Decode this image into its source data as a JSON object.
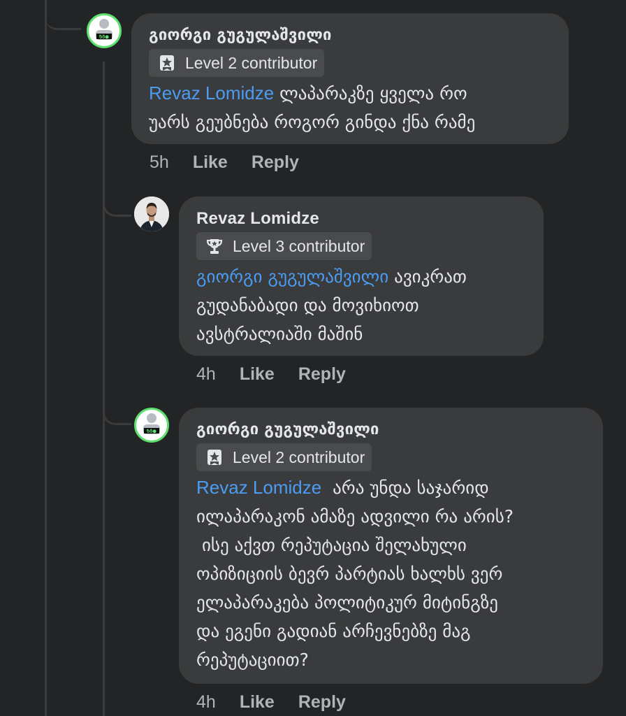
{
  "comments": [
    {
      "author": "გიორგი გუგულაშვილი",
      "badge": "Level 2 contributor",
      "badge_icon": "star-ribbon-icon",
      "mention": "Revaz Lomidze",
      "lines": [
        "ლაპარაკზე ყველა რო",
        "უარს გეუბნება როგორ გინდა ქნა რამე"
      ],
      "time": "5h",
      "like": "Like",
      "reply": "Reply"
    },
    {
      "author": "Revaz Lomidze",
      "badge": "Level 3 contributor",
      "badge_icon": "trophy-icon",
      "mention": "გიორგი გუგულაშვილი",
      "lines": [
        "ავიკრათ",
        "გუდანაბადი და მოვიხიოთ",
        "ავსტრალიაში მაშინ"
      ],
      "time": "4h",
      "like": "Like",
      "reply": "Reply"
    },
    {
      "author": "გიორგი გუგულაშვილი",
      "badge": "Level 2 contributor",
      "badge_icon": "star-ribbon-icon",
      "mention": "Revaz Lomidze",
      "lines": [
        " არა უნდა საჯარიდ",
        "ილაპარაკონ ამაზე ადვილი რა არის?",
        " ისე აქვთ რეპუტაცია შელახული",
        "ოპიზიციის ბევრ პარტიას ხალხს ვერ",
        "ელაპარაკება პოლიტიკურ მიტინგზე",
        "და ეგენი გადიან არჩევნებზე მაგ",
        "რეპუტაციით?"
      ],
      "time": "4h",
      "like": "Like",
      "reply": "Reply"
    }
  ],
  "colors": {
    "background": "#232425",
    "bubble": "#3a3b3c",
    "mention": "#4b9cf2",
    "meta": "#b0b3b8",
    "avatar_ring": "#5ee06f"
  }
}
